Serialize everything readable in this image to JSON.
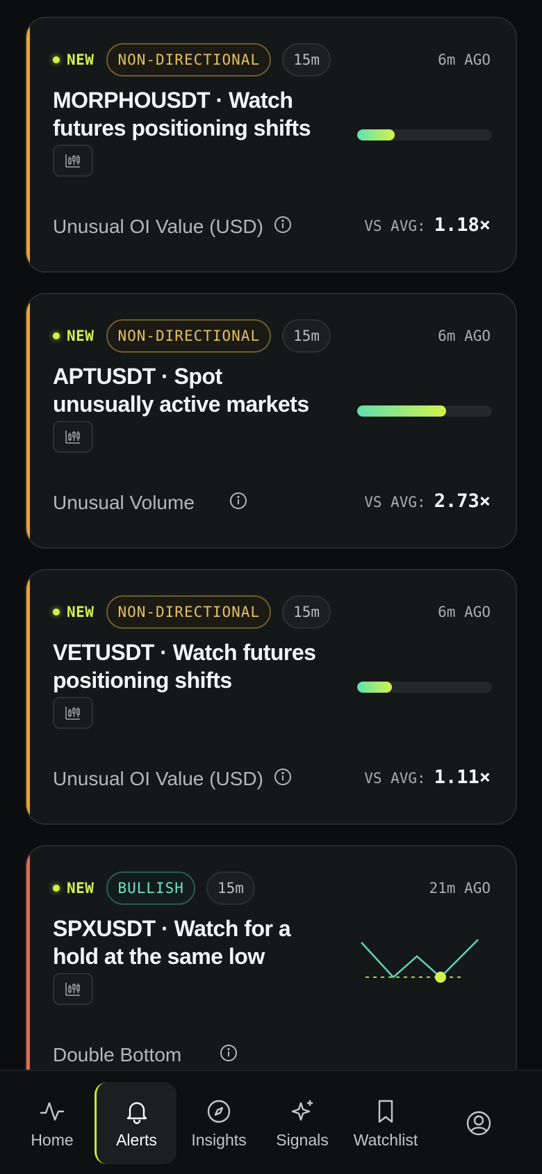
{
  "alerts": [
    {
      "new_label": "NEW",
      "bias": "NON-DIRECTIONAL",
      "timeframe": "15m",
      "age": "6m AGO",
      "title": "MORPHOUSDT · Watch futures positioning shifts",
      "metric": "Unusual OI Value (USD)",
      "vs_label": "VS AVG:",
      "vs_value": "1.18×",
      "strength_pct": 28,
      "accent": "#f0a52a"
    },
    {
      "new_label": "NEW",
      "bias": "NON-DIRECTIONAL",
      "timeframe": "15m",
      "age": "6m AGO",
      "title": "APTUSDT · Spot unusually active markets",
      "metric": "Unusual Volume",
      "vs_label": "VS AVG:",
      "vs_value": "2.73×",
      "strength_pct": 66,
      "accent": "#f0a52a"
    },
    {
      "new_label": "NEW",
      "bias": "NON-DIRECTIONAL",
      "timeframe": "15m",
      "age": "6m AGO",
      "title": "VETUSDT · Watch futures positioning shifts",
      "metric": "Unusual OI Value (USD)",
      "vs_label": "VS AVG:",
      "vs_value": "1.11×",
      "strength_pct": 26,
      "accent": "#f0a52a"
    },
    {
      "new_label": "NEW",
      "bias": "BULLISH",
      "timeframe": "15m",
      "age": "21m AGO",
      "title": "SPXUSDT · Watch for a hold at the same low",
      "metric": "Double Bottom",
      "pattern_icon": "double-bottom-sparkline",
      "accent": "#e8694f"
    }
  ],
  "nav": {
    "home": "Home",
    "alerts": "Alerts",
    "insights": "Insights",
    "signals": "Signals",
    "watchlist": "Watchlist",
    "active": "alerts"
  },
  "icons": {
    "chart": "candlestick-chart-icon",
    "info": "info-icon",
    "home": "pulse-icon",
    "alerts": "bell-icon",
    "insights": "compass-icon",
    "signals": "sparkles-icon",
    "watchlist": "bookmark-icon",
    "profile": "user-circle-icon"
  }
}
